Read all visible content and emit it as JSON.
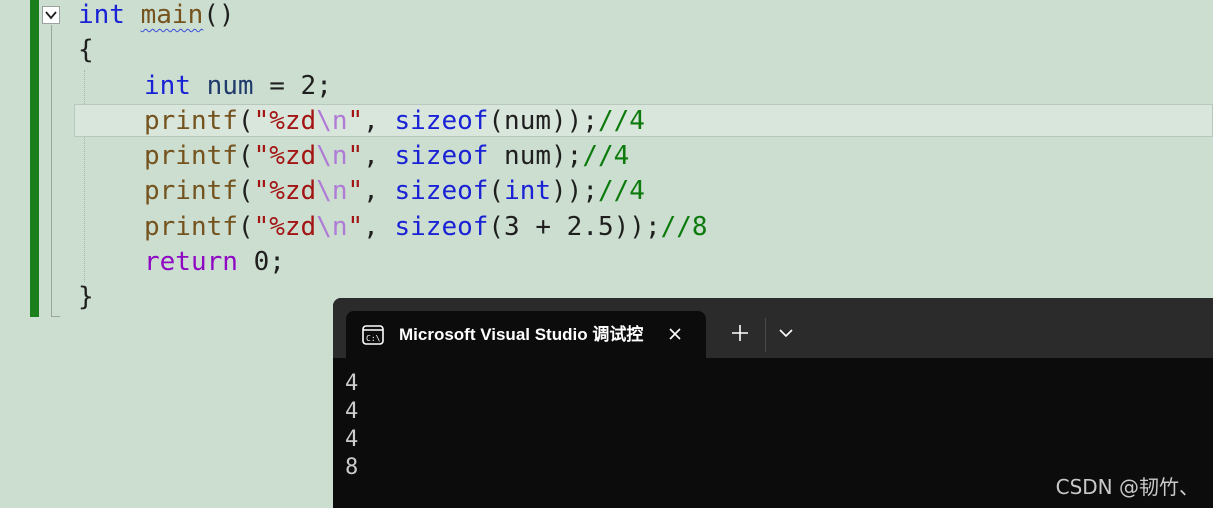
{
  "editor": {
    "lines": [
      {
        "int": "int",
        "main": "main",
        "parens": "()"
      },
      {
        "text": "{"
      },
      {
        "int": "int",
        "var": "num",
        "rest": " = 2;"
      },
      {
        "fn": "printf",
        "open": "(",
        "str_a": "\"%zd",
        "esc": "\\n",
        "str_b": "\"",
        "comma": ", ",
        "kw": "sizeof",
        "args": "(num));",
        "comment": "//4"
      },
      {
        "fn": "printf",
        "open": "(",
        "str_a": "\"%zd",
        "esc": "\\n",
        "str_b": "\"",
        "comma": ", ",
        "kw": "sizeof",
        "args": " num);",
        "comment": "//4"
      },
      {
        "fn": "printf",
        "open": "(",
        "str_a": "\"%zd",
        "esc": "\\n",
        "str_b": "\"",
        "comma": ", ",
        "kw": "sizeof",
        "paren": "(",
        "kw2": "int",
        "args": "));",
        "comment": "//4"
      },
      {
        "fn": "printf",
        "open": "(",
        "str_a": "\"%zd",
        "esc": "\\n",
        "str_b": "\"",
        "comma": ", ",
        "kw": "sizeof",
        "args": "(3 + 2.5));",
        "comment": "//8"
      },
      {
        "ret": "return",
        "rest": " 0;"
      },
      {
        "text": "}"
      }
    ]
  },
  "terminal": {
    "tab_title": "Microsoft Visual Studio 调试控",
    "output": [
      "4",
      "4",
      "4",
      "8"
    ]
  },
  "watermark": "CSDN @韧竹、",
  "colors": {
    "editor_bg": "#cbdecf",
    "keyword": "#1a22d6",
    "string": "#a31515",
    "comment": "#0c7a0c",
    "change_bar": "#1b7f1b",
    "terminal_bg": "#0c0c0c"
  }
}
